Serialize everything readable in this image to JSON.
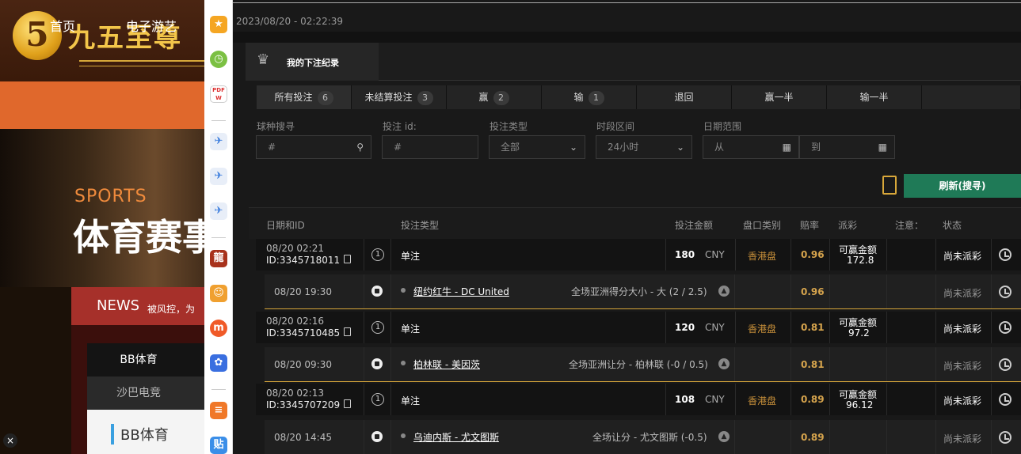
{
  "site": {
    "logo_text": "九五至尊",
    "logo_badge": "5",
    "nav": [
      "首页",
      "电子游艺"
    ],
    "hero_sports": "SPORTS",
    "hero_title": "体育赛事",
    "news_label": "NEWS",
    "news_sub": "被风控，为",
    "tab_bb": "BB体育",
    "tab_sb": "沙巴电竞",
    "card_title": "BB体育",
    "close": "×"
  },
  "launcher_icons": [
    "star-icon",
    "clock-app-icon",
    "pdf-icon",
    "bird-icon",
    "bird-icon",
    "bird-icon",
    "game-dragon-icon",
    "game-cartoon-icon",
    "live-icon",
    "baidu-paw-icon",
    "app-orange-icon",
    "tieba-icon"
  ],
  "header": {
    "datetime": "2023/08/20 - 02:22:39",
    "title": "我的下注纪录"
  },
  "tabs": [
    {
      "label": "所有投注",
      "count": "6"
    },
    {
      "label": "未结算投注",
      "count": "3"
    },
    {
      "label": "赢",
      "count": "2"
    },
    {
      "label": "输",
      "count": "1"
    },
    {
      "label": "退回",
      "count": ""
    },
    {
      "label": "赢一半",
      "count": ""
    },
    {
      "label": "输一半",
      "count": ""
    }
  ],
  "filters": {
    "sport_label": "球种搜寻",
    "sport_placeholder": "#",
    "betid_label": "投注 id:",
    "betid_placeholder": "#",
    "type_label": "投注类型",
    "type_value": "全部",
    "period_label": "时段区间",
    "period_value": "24小时",
    "date_label": "日期范围",
    "date_from": "从",
    "date_to": "到",
    "refresh": "刷新(搜寻)"
  },
  "columns": {
    "date": "日期和ID",
    "type": "投注类型",
    "amount": "投注金额",
    "market": "盘口类别",
    "odds": "赔率",
    "payout": "派彩",
    "note": "注意：",
    "status": "状态"
  },
  "bets": [
    {
      "time": "08/20 02:21",
      "id": "ID:3345718011",
      "bet_type": "单注",
      "amount": "180",
      "currency": "CNY",
      "market": "香港盘",
      "odds": "0.96",
      "payout_label": "可赢金额",
      "payout_value": "172.8",
      "status": "尚未派彩",
      "detail": {
        "time": "08/20 19:30",
        "match": "纽约红牛 - DC United",
        "selection": "全场亚洲得分大小 - 大 (2 / 2.5)",
        "odds": "0.96",
        "status": "尚未派彩"
      }
    },
    {
      "time": "08/20 02:16",
      "id": "ID:3345710485",
      "bet_type": "单注",
      "amount": "120",
      "currency": "CNY",
      "market": "香港盘",
      "odds": "0.81",
      "payout_label": "可赢金额",
      "payout_value": "97.2",
      "status": "尚未派彩",
      "detail": {
        "time": "08/20 09:30",
        "match": "柏林联 - 美因茨",
        "selection": "全场亚洲让分 - 柏林联 (-0 / 0.5)",
        "odds": "0.81",
        "status": "尚未派彩"
      }
    },
    {
      "time": "08/20 02:13",
      "id": "ID:3345707209",
      "bet_type": "单注",
      "amount": "108",
      "currency": "CNY",
      "market": "香港盘",
      "odds": "0.89",
      "payout_label": "可赢金额",
      "payout_value": "96.12",
      "status": "尚未派彩",
      "detail": {
        "time": "08/20 14:45",
        "match": "乌迪内斯 - 尤文图斯",
        "selection": "全场让分 - 尤文图斯 (-0.5)",
        "odds": "0.89",
        "status": "尚未派彩"
      }
    }
  ]
}
